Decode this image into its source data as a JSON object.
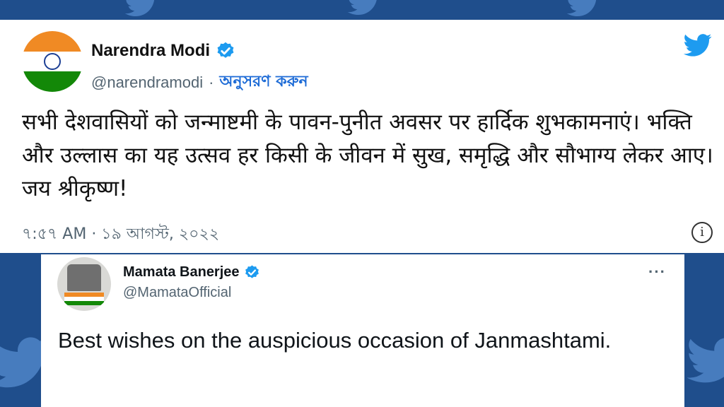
{
  "tweet1": {
    "display_name": "Narendra Modi",
    "handle": "@narendramodi",
    "separator": "·",
    "follow_label": "অনুসরণ করুন",
    "text": "सभी देशवासियों को जन्माष्टमी के पावन-पुनीत अवसर पर हार्दिक शुभकामनाएं। भक्ति और उल्लास का यह उत्सव हर किसी के जीवन में सुख, समृद्धि और सौभाग्य लेकर आए। जय श्रीकृष्ण!",
    "timestamp": "৭:৫৭ AM · ১৯ আগস্ট, ২০২২",
    "info_glyph": "i"
  },
  "tweet2": {
    "display_name": "Mamata Banerjee",
    "handle": "@MamataOfficial",
    "more_glyph": "···",
    "text": "Best wishes on the auspicious occasion of Janmashtami."
  },
  "icons": {
    "verified": "verified-badge-icon",
    "twitter": "twitter-bird-icon",
    "info": "info-icon",
    "more": "more-options-icon"
  },
  "colors": {
    "background": "#1f4e8c",
    "twitter_blue": "#1d9bf0",
    "follow_link": "#1d6bd6",
    "saffron": "#f08a24",
    "india_green": "#138808"
  }
}
